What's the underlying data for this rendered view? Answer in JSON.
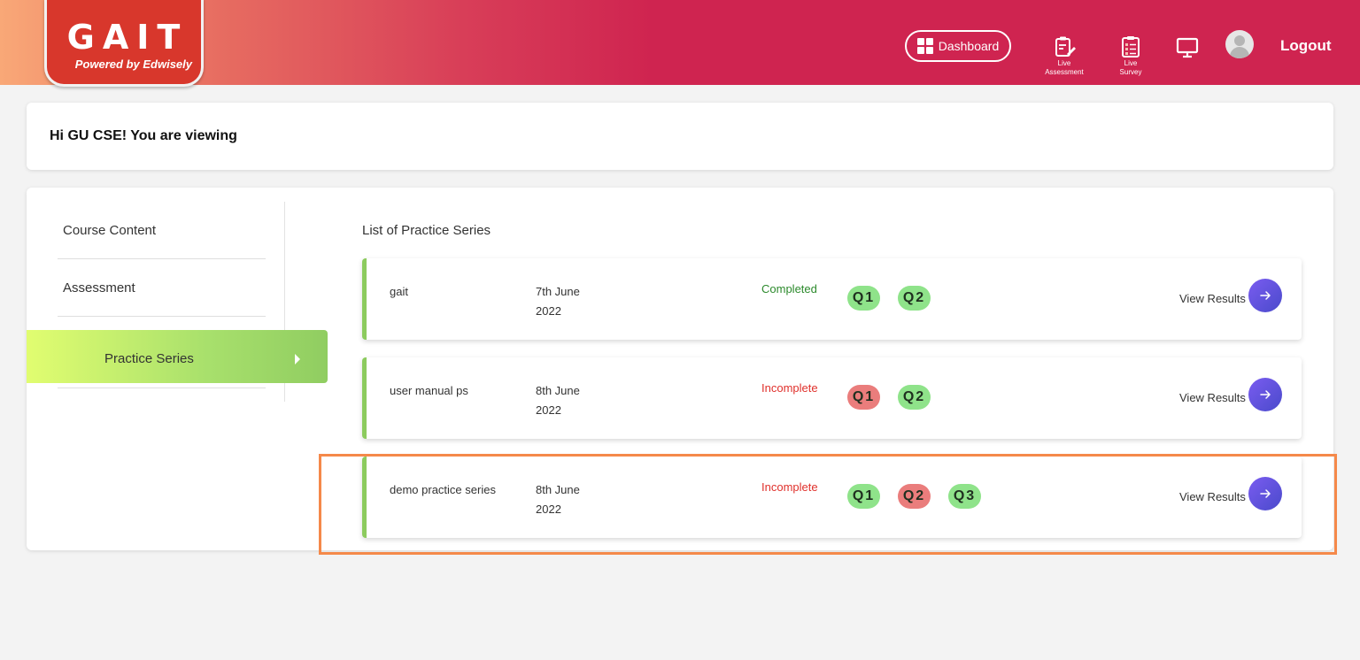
{
  "header": {
    "logo_title": "GAIT",
    "logo_subtitle": "Powered by Edwisely",
    "dashboard_label": "Dashboard",
    "live_assessment_label": "Live\nAssessment",
    "live_survey_label": "Live\nSurvey",
    "logout_label": "Logout"
  },
  "greeting": "Hi GU CSE! You are viewing",
  "sidebar": {
    "items": [
      {
        "label": "Course Content"
      },
      {
        "label": "Assessment"
      },
      {
        "label": "Practice Series",
        "active": true
      }
    ]
  },
  "main": {
    "list_title": "List of Practice Series",
    "rows": [
      {
        "name": "gait",
        "date": "7th June 2022",
        "status": "Completed",
        "questions": [
          {
            "label": "Q1",
            "state": "correct"
          },
          {
            "label": "Q2",
            "state": "correct"
          }
        ],
        "view_label": "View Results"
      },
      {
        "name": "user manual ps",
        "date": "8th June 2022",
        "status": "Incomplete",
        "questions": [
          {
            "label": "Q1",
            "state": "wrong"
          },
          {
            "label": "Q2",
            "state": "correct"
          }
        ],
        "view_label": "View Results"
      },
      {
        "name": "demo practice series",
        "date": "8th June 2022",
        "status": "Incomplete",
        "questions": [
          {
            "label": "Q1",
            "state": "correct"
          },
          {
            "label": "Q2",
            "state": "wrong"
          },
          {
            "label": "Q3",
            "state": "correct"
          }
        ],
        "view_label": "View Results"
      }
    ]
  },
  "colors": {
    "header_red": "#cf2450",
    "logo_red": "#d8372c",
    "completed_green": "#2c8a2c",
    "incomplete_red": "#e0312c",
    "q_correct": "#8fe38a",
    "q_wrong": "#ea7d7c",
    "arrow_purple": "#5b4fe0",
    "highlight_orange": "#f5894a"
  }
}
